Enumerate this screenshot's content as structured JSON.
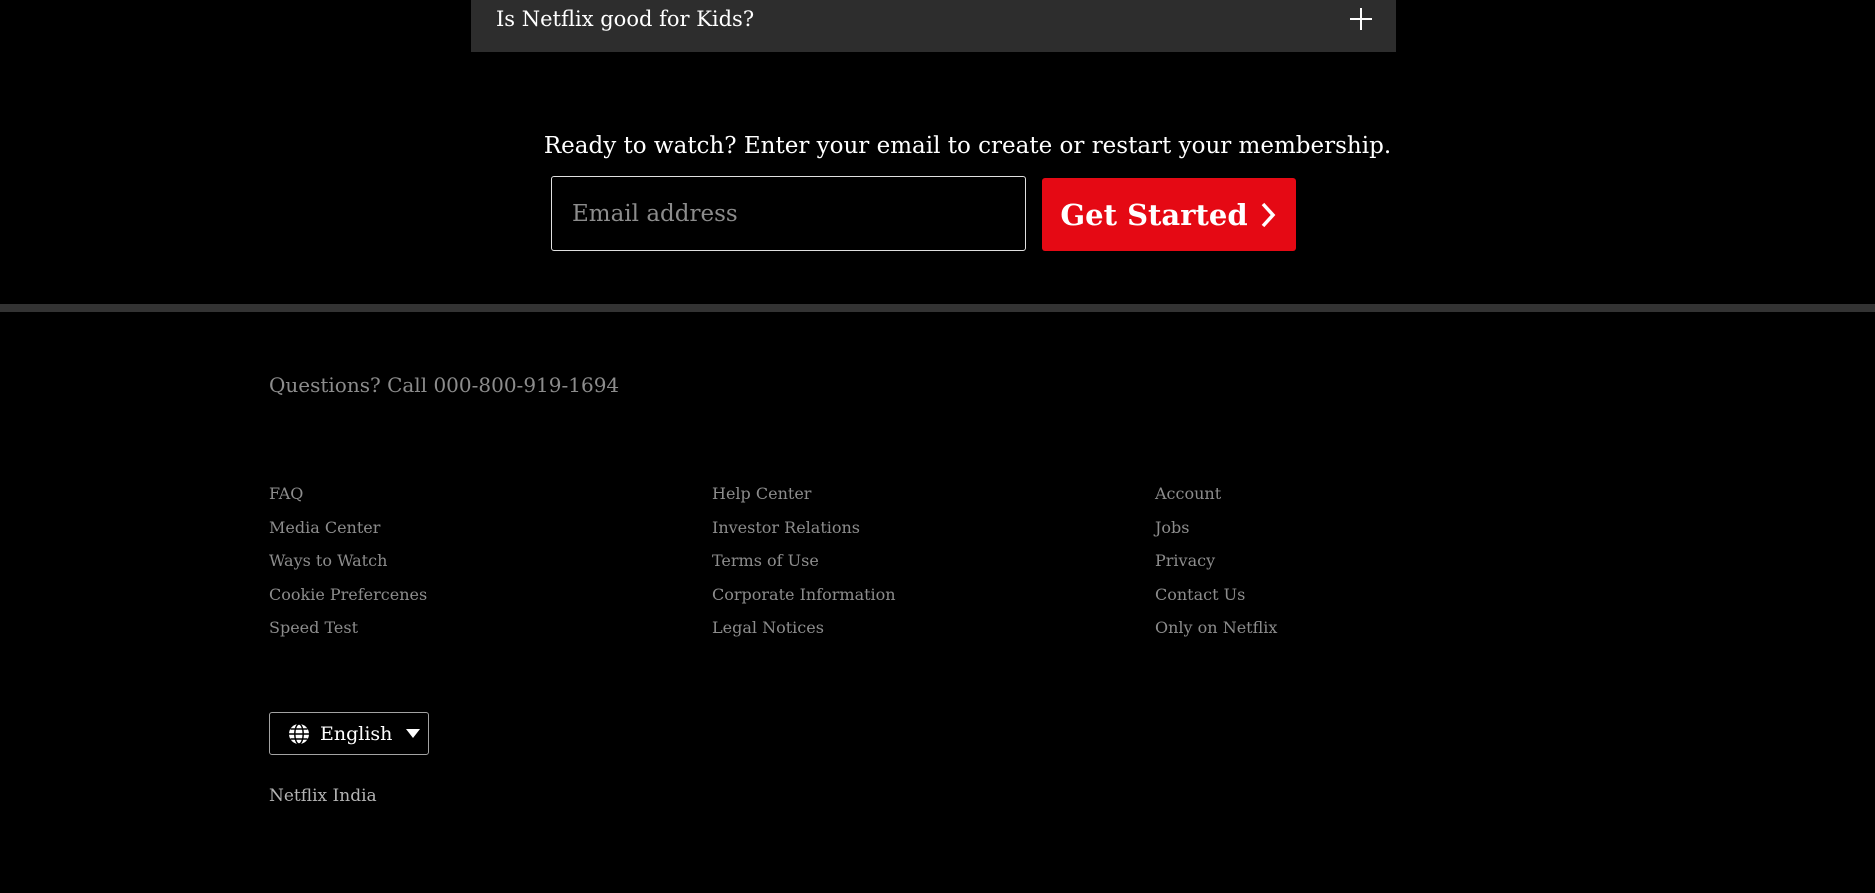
{
  "faq": {
    "question": "Is Netflix good for Kids?",
    "toggle_icon": "plus-icon"
  },
  "signup": {
    "prompt": "Ready to watch? Enter your email to create or restart your membership.",
    "email_placeholder": "Email address",
    "button_label": "Get Started",
    "button_icon": "chevron-right-icon",
    "accent_color": "#e50914"
  },
  "footer": {
    "phone_text": "Questions? Call 000-800-919-1694",
    "columns": [
      [
        "FAQ",
        "Media Center",
        "Ways to Watch",
        "Cookie Prefercenes",
        "Speed Test"
      ],
      [
        "Help Center",
        "Investor Relations",
        "Terms of Use",
        "Corporate Information",
        "Legal Notices"
      ],
      [
        "Account",
        "Jobs",
        "Privacy",
        "Contact Us",
        "Only on Netflix"
      ]
    ],
    "language": {
      "selected": "English",
      "icon": "globe-icon"
    },
    "country": "Netflix India"
  }
}
